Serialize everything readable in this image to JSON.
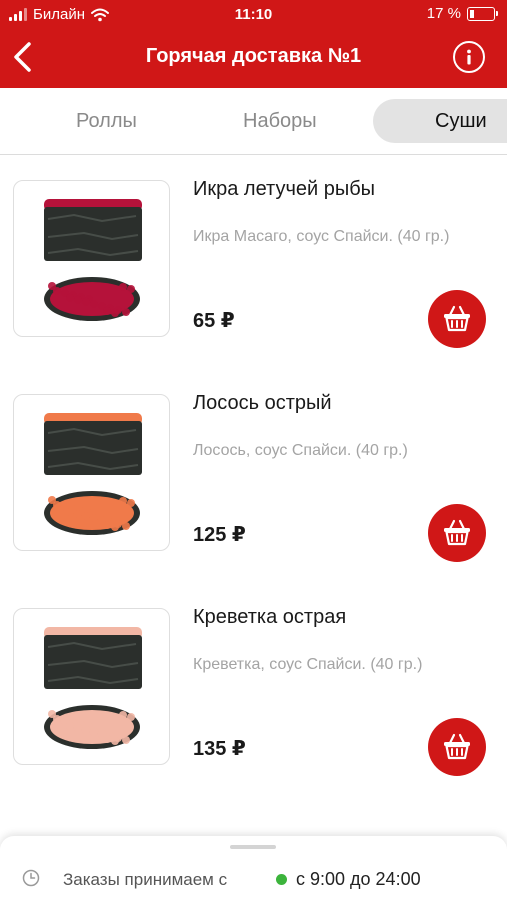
{
  "status_bar": {
    "carrier": "Билайн",
    "time": "11:10",
    "battery": "17 %",
    "battery_level": 0.17
  },
  "header": {
    "title": "Горячая доставка №1",
    "background": "#d01717"
  },
  "tabs": [
    {
      "label": "Роллы",
      "selected": false
    },
    {
      "label": "Наборы",
      "selected": false
    },
    {
      "label": "Суши",
      "selected": true
    }
  ],
  "products": [
    {
      "name": "Икра летучей рыбы",
      "description": "Икра Масаго, соус Спайси. (40 гр.)",
      "price": "65 ₽",
      "topping_color": "#b5123a"
    },
    {
      "name": "Лосось острый",
      "description": "Лосось, соус Спайси. (40 гр.)",
      "price": "125 ₽",
      "topping_color": "#f07a4a"
    },
    {
      "name": "Креветка острая",
      "description": "Креветка, соус Спайси. (40 гр.)",
      "price": "135 ₽",
      "topping_color": "#f2b7a5"
    }
  ],
  "footer": {
    "label": "Заказы принимаем с",
    "hours": "с 9:00 до 24:00",
    "status_color": "#3cb43c"
  },
  "icons": {
    "back": "chevron-left-icon",
    "info": "info-icon",
    "cart": "basket-icon",
    "clock": "clock-icon",
    "wifi": "wifi-icon",
    "signal": "signal-icon",
    "battery": "battery-icon"
  }
}
